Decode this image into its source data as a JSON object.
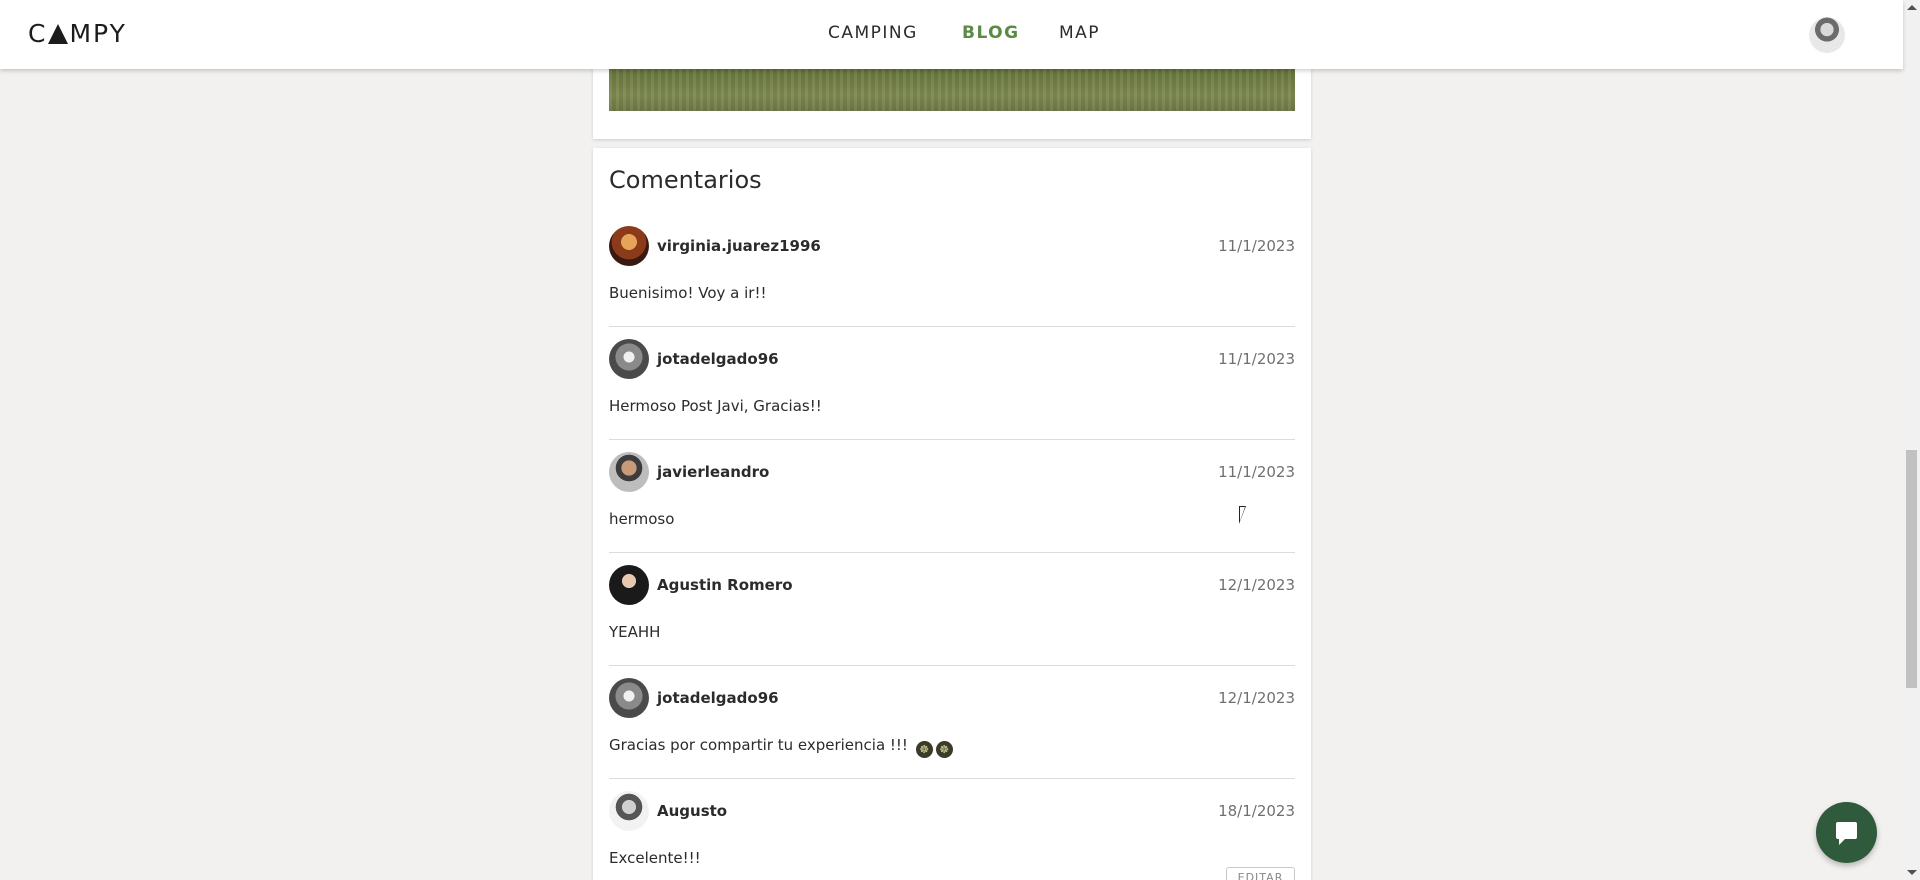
{
  "header": {
    "logo": "CAMPY",
    "logo_prefix": "C",
    "logo_suffix": "MPY",
    "nav": [
      {
        "label": "CAMPING",
        "active": false
      },
      {
        "label": "BLOG",
        "active": true
      },
      {
        "label": "MAP",
        "active": false
      }
    ],
    "accent_color": "#5a8a43"
  },
  "comments": {
    "title": "Comentarios",
    "items": [
      {
        "username": "virginia.juarez1996",
        "date": "11/1/2023",
        "text": "Buenisimo! Voy a ir!!"
      },
      {
        "username": "jotadelgado96",
        "date": "11/1/2023",
        "text": "Hermoso Post Javi, Gracias!!"
      },
      {
        "username": "javierleandro",
        "date": "11/1/2023",
        "text": "hermoso"
      },
      {
        "username": "Agustin Romero",
        "date": "12/1/2023",
        "text": "YEAHH"
      },
      {
        "username": "jotadelgado96",
        "date": "12/1/2023",
        "text": "Gracias por compartir tu experiencia !!!",
        "emojis": [
          "☸",
          "☸"
        ]
      },
      {
        "username": "Augusto",
        "date": "18/1/2023",
        "text": "Excelente!!!"
      }
    ],
    "edit_label": "EDITAR"
  },
  "chat": {
    "icon": "chat-bubble-icon",
    "color": "#2f5a3b"
  }
}
